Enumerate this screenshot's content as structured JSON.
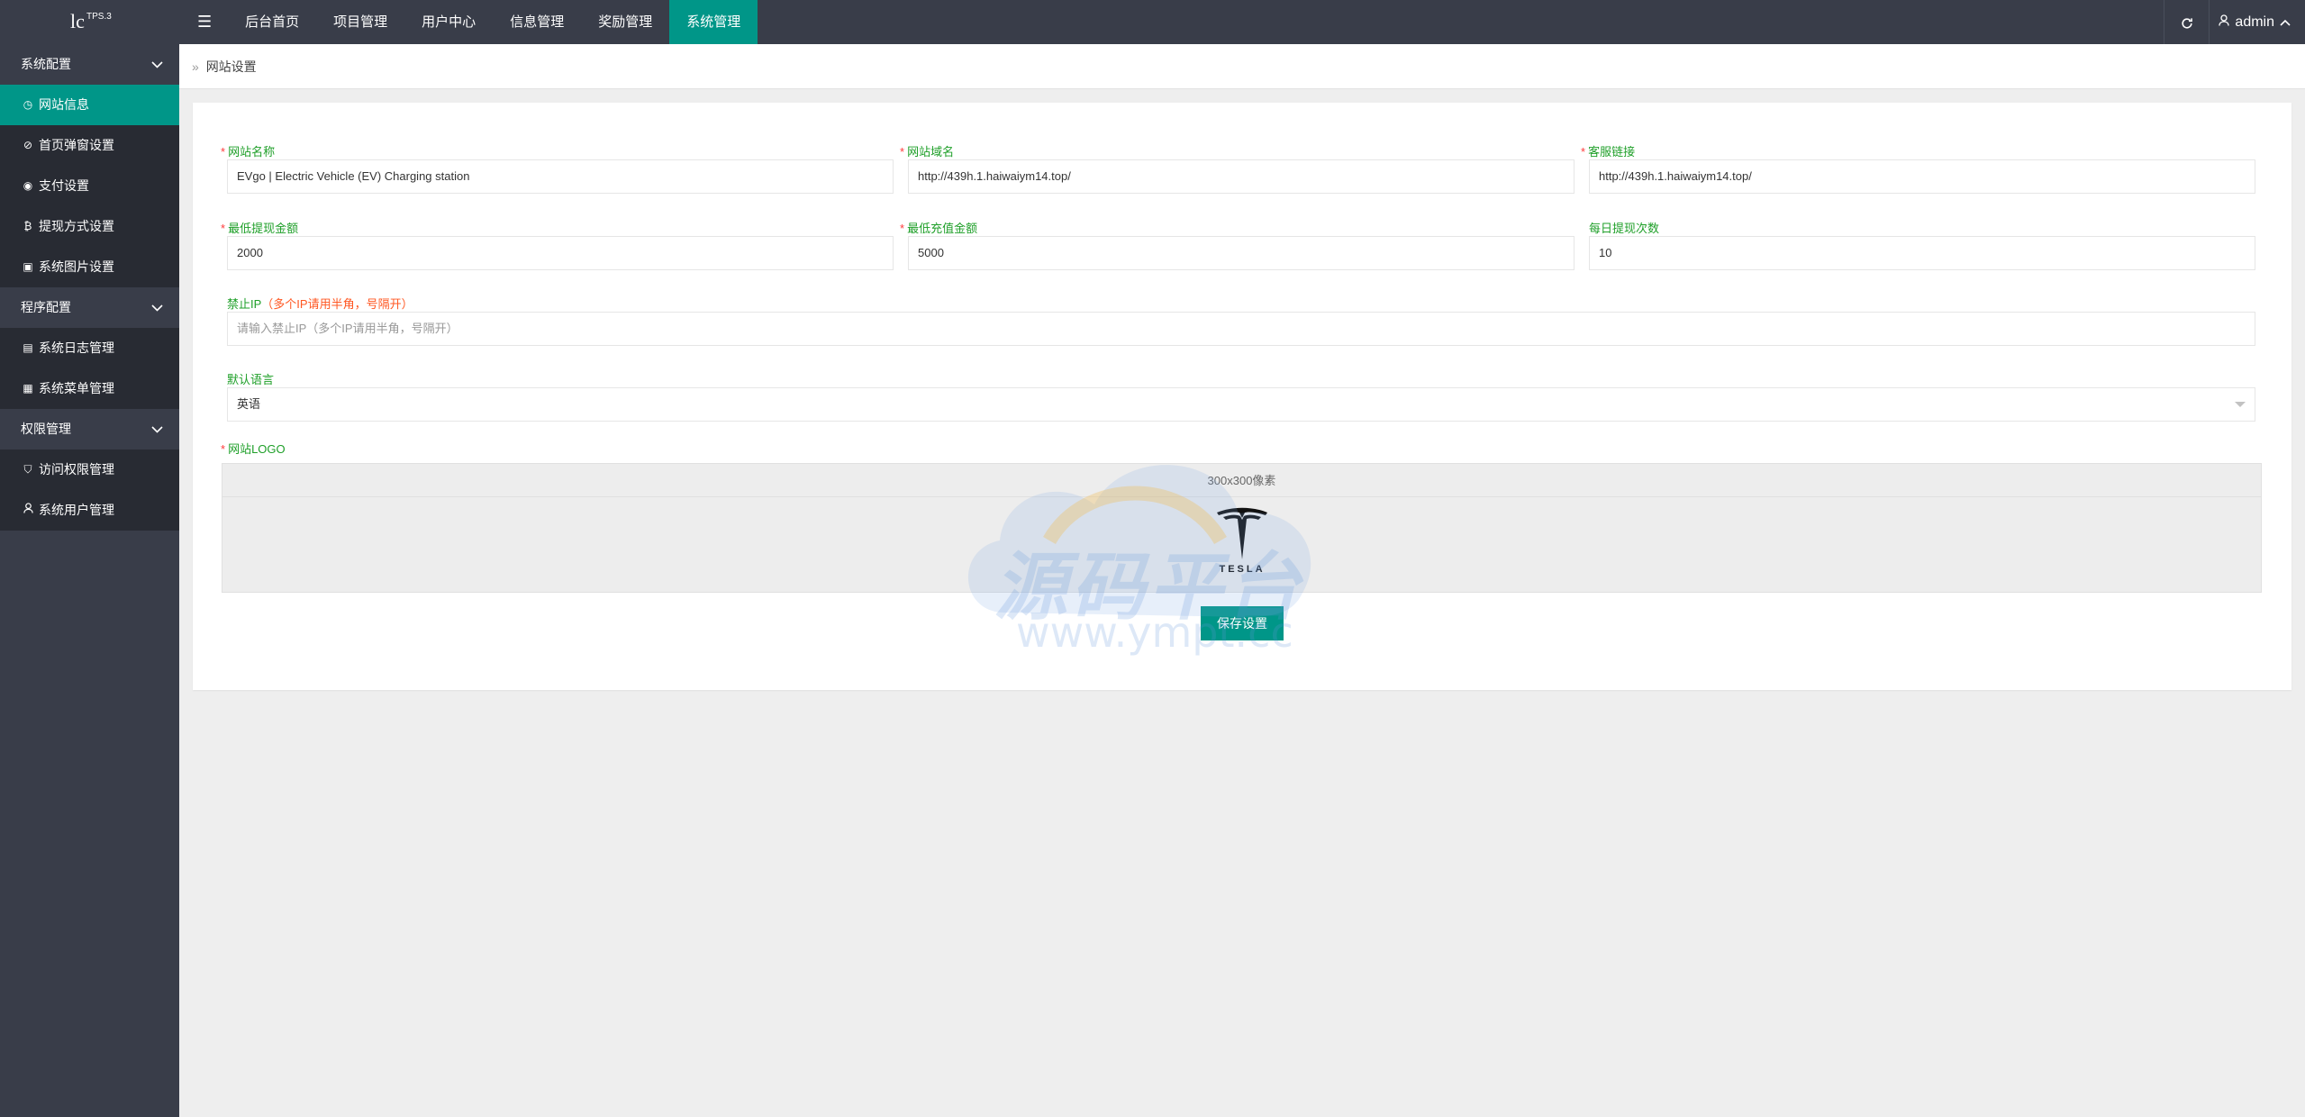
{
  "app": {
    "logo_text": "lc",
    "version": "TPS.3"
  },
  "topnav": {
    "menu_icon": "hamburger-icon",
    "items": [
      {
        "label": "后台首页"
      },
      {
        "label": "项目管理"
      },
      {
        "label": "用户中心"
      },
      {
        "label": "信息管理"
      },
      {
        "label": "奖励管理"
      },
      {
        "label": "系统管理",
        "active": true
      }
    ],
    "refresh_icon": "refresh-icon",
    "user": {
      "icon": "user-icon",
      "name": "admin"
    }
  },
  "sidebar": {
    "groups": [
      {
        "label": "系统配置",
        "items": [
          {
            "label": "网站信息",
            "icon": "dashboard-icon",
            "active": true
          },
          {
            "label": "首页弹窗设置",
            "icon": "popup-icon"
          },
          {
            "label": "支付设置",
            "icon": "radio-icon"
          },
          {
            "label": "提现方式设置",
            "icon": "bitcoin-icon"
          },
          {
            "label": "系统图片设置",
            "icon": "image-icon"
          }
        ]
      },
      {
        "label": "程序配置",
        "items": [
          {
            "label": "系统日志管理",
            "icon": "log-icon"
          },
          {
            "label": "系统菜单管理",
            "icon": "menu-table-icon"
          }
        ]
      },
      {
        "label": "权限管理",
        "items": [
          {
            "label": "访问权限管理",
            "icon": "shield-check-icon"
          },
          {
            "label": "系统用户管理",
            "icon": "user-icon"
          }
        ]
      }
    ]
  },
  "breadcrumb": {
    "separator": "»",
    "label": "网站设置"
  },
  "form": {
    "site_name": {
      "label": "网站名称",
      "value": "EVgo | Electric Vehicle (EV) Charging station"
    },
    "site_domain": {
      "label": "网站域名",
      "value": "http://439h.1.haiwaiym14.top/"
    },
    "service_link": {
      "label": "客服链接",
      "value": "http://439h.1.haiwaiym14.top/"
    },
    "min_withdraw": {
      "label": "最低提现金额",
      "value": "2000"
    },
    "min_recharge": {
      "label": "最低充值金额",
      "value": "5000"
    },
    "daily_withdraw": {
      "label": "每日提现次数",
      "value": "10"
    },
    "ban_ip": {
      "label": "禁止IP",
      "hint": "（多个IP请用半角，号隔开）",
      "placeholder": "请输入禁止IP（多个IP请用半角，号隔开）"
    },
    "default_lang": {
      "label": "默认语言",
      "value": "英语"
    },
    "site_logo": {
      "label": "网站LOGO",
      "size_hint": "300x300像素",
      "image_text": "TESLA"
    },
    "save_label": "保存设置"
  },
  "watermark": {
    "text": "源码平台",
    "url": "www.ympt.cc"
  },
  "colors": {
    "accent": "#009688",
    "dark": "#393d49",
    "sidebar_sub": "#282b33",
    "label_green": "#1e9f28",
    "required_red": "#ff3b3b"
  }
}
